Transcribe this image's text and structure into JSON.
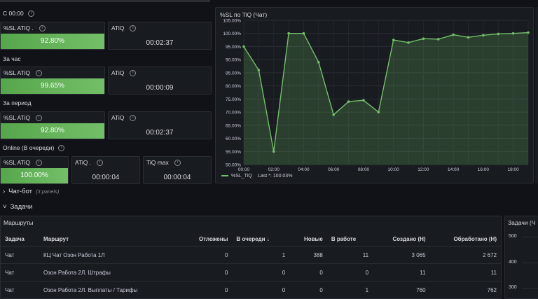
{
  "sections": {
    "since_midnight": "С 00:00",
    "per_hour": "За час",
    "per_period": "За период",
    "online": "Online (В очереди)"
  },
  "stats": {
    "sl_since_midnight": {
      "title": "%SL ATiQ .",
      "value": "92.80%",
      "level_percent": 92.8
    },
    "atiq_since_midnight": {
      "title": "ATiQ",
      "value": "00:02:37"
    },
    "sl_hour": {
      "title": "%SL ATiQ",
      "value": "99.65%",
      "level_percent": 99.65
    },
    "atiq_hour": {
      "title": "ATiQ",
      "value": "00:00:09"
    },
    "sl_period": {
      "title": "%SL ATiQ",
      "value": "92.80%",
      "level_percent": 92.8
    },
    "atiq_period": {
      "title": "ATiQ",
      "value": "00:02:37"
    },
    "sl_online": {
      "title": "%SL ATiQ",
      "value": "100.00%",
      "level_percent": 100
    },
    "atiq_online": {
      "title": "ATiQ .",
      "value": "00:00:04"
    },
    "tiq_max": {
      "title": "TiQ max",
      "value": "00:00:04"
    }
  },
  "chart_data": {
    "type": "line",
    "title": "%SL по TiQ (Чат)",
    "x": [
      "00:00",
      "01:00",
      "02:00",
      "03:00",
      "04:00",
      "05:00",
      "06:00",
      "07:00",
      "08:00",
      "09:00",
      "10:00",
      "11:00",
      "12:00",
      "13:00",
      "14:00",
      "15:00",
      "16:00",
      "17:00",
      "18:00",
      "19:00"
    ],
    "x_tick_labels": [
      "00:00",
      "02:00",
      "04:00",
      "06:00",
      "08:00",
      "10:00",
      "12:00",
      "14:00",
      "16:00",
      "18:00"
    ],
    "y_tick_labels": [
      "50.00%",
      "55.00%",
      "60.00%",
      "65.00%",
      "70.00%",
      "75.00%",
      "80.00%",
      "85.00%",
      "90.00%",
      "95.00%",
      "100.00%",
      "105.00%"
    ],
    "ylim": [
      50,
      105
    ],
    "grid": true,
    "legend_placement": "bottom-left",
    "series": [
      {
        "name": "%SL_TiQ",
        "values": [
          95.0,
          86.0,
          55.0,
          100.0,
          100.0,
          89.0,
          69.0,
          74.0,
          74.5,
          70.0,
          97.5,
          96.5,
          98.0,
          97.8,
          99.5,
          98.5,
          99.3,
          99.8,
          100.0,
          100.3
        ]
      }
    ],
    "legend_label": "%SL_TiQ",
    "legend_last": "Last *: 100.03%",
    "color": "#73bf69"
  },
  "rows": {
    "chat_bot": {
      "label": "Чат-бот",
      "sub": "(3 panels)"
    },
    "tasks": {
      "label": "Задачи"
    }
  },
  "routes_panel": {
    "title": "Маршруты",
    "columns": [
      "Задача",
      "Маршрут",
      "Отложены",
      "В очереди",
      "Новые",
      "В работе",
      "Создано (Н)",
      "Обработано (Н)"
    ],
    "rows": [
      [
        "Чат",
        "КЦ Чат Озон Работа 1Л",
        "0",
        "1",
        "388",
        "11",
        "3 065",
        "2 672"
      ],
      [
        "Чат",
        "Озон Работа 2Л. Штрафы",
        "0",
        "0",
        "0",
        "0",
        "11",
        "11"
      ],
      [
        "Чат",
        "Озон Работа 2Л. Выплаты / Тарифы",
        "0",
        "0",
        "0",
        "1",
        "760",
        "762"
      ]
    ]
  },
  "tasks_panel": {
    "title": "Задачи (Ч",
    "y_ticks": [
      "500",
      "400",
      "300"
    ]
  }
}
